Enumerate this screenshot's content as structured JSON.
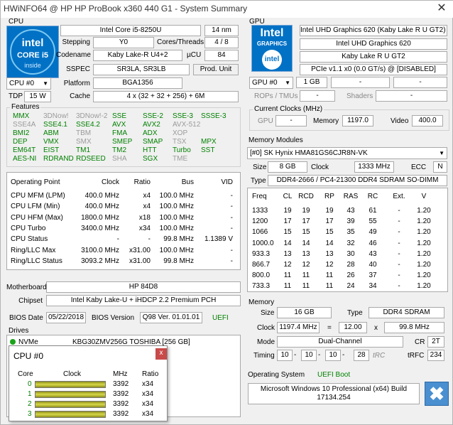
{
  "window": {
    "title": "HWiNFO64 @ HP HP ProBook x360 440 G1 - System Summary",
    "close": "✕"
  },
  "cpu": {
    "section": "CPU",
    "brand_word": "intel",
    "brand_series": "CORE i5",
    "brand_inside": "inside",
    "name": "Intel Core i5-8250U",
    "process": "14 nm",
    "stepping_label": "Stepping",
    "stepping": "Y0",
    "cores_label": "Cores/Threads",
    "cores": "4 / 8",
    "codename_label": "Codename",
    "codename": "Kaby Lake-R U4+2",
    "ucu_label": "µCU",
    "ucu": "84",
    "sspec_label": "SSPEC",
    "sspec": "SR3LA, SR3LB",
    "prod_unit": "Prod. Unit",
    "cpu_select": "CPU #0",
    "platform_label": "Platform",
    "platform": "BGA1356",
    "tdp_label": "TDP",
    "tdp": "15 W",
    "cache_label": "Cache",
    "cache": "4 x (32 + 32 + 256) + 6M"
  },
  "features": {
    "title": "Features",
    "items": [
      {
        "t": "MMX",
        "on": true
      },
      {
        "t": "3DNow!",
        "on": false
      },
      {
        "t": "3DNow!-2",
        "on": false
      },
      {
        "t": "SSE",
        "on": true
      },
      {
        "t": "SSE-2",
        "on": true
      },
      {
        "t": "SSE-3",
        "on": true
      },
      {
        "t": "SSSE-3",
        "on": true
      },
      {
        "t": "SSE4A",
        "on": false
      },
      {
        "t": "SSE4.1",
        "on": true
      },
      {
        "t": "SSE4.2",
        "on": true
      },
      {
        "t": "AVX",
        "on": true
      },
      {
        "t": "AVX2",
        "on": true
      },
      {
        "t": "AVX-512",
        "on": false
      },
      {
        "t": "BMI2",
        "on": true
      },
      {
        "t": "ABM",
        "on": true
      },
      {
        "t": "TBM",
        "on": false
      },
      {
        "t": "FMA",
        "on": true
      },
      {
        "t": "ADX",
        "on": true
      },
      {
        "t": "XOP",
        "on": false
      },
      {
        "t": "DEP",
        "on": true
      },
      {
        "t": "VMX",
        "on": true
      },
      {
        "t": "SMX",
        "on": false
      },
      {
        "t": "SMEP",
        "on": true
      },
      {
        "t": "SMAP",
        "on": true
      },
      {
        "t": "TSX",
        "on": false
      },
      {
        "t": "MPX",
        "on": true
      },
      {
        "t": "EM64T",
        "on": true
      },
      {
        "t": "EIST",
        "on": true
      },
      {
        "t": "TM1",
        "on": true
      },
      {
        "t": "TM2",
        "on": true
      },
      {
        "t": "HTT",
        "on": true
      },
      {
        "t": "Turbo",
        "on": true
      },
      {
        "t": "SST",
        "on": true
      },
      {
        "t": "AES-NI",
        "on": true
      },
      {
        "t": "RDRAND",
        "on": true
      },
      {
        "t": "RDSEED",
        "on": true
      },
      {
        "t": "SHA",
        "on": false
      },
      {
        "t": "SGX",
        "on": true
      },
      {
        "t": "TME",
        "on": false
      }
    ]
  },
  "op": {
    "headers": [
      "Operating Point",
      "Clock",
      "Ratio",
      "Bus",
      "VID"
    ],
    "rows": [
      [
        "CPU MFM (LPM)",
        "400.0 MHz",
        "x4",
        "100.0 MHz",
        "-"
      ],
      [
        "CPU LFM (Min)",
        "400.0 MHz",
        "x4",
        "100.0 MHz",
        "-"
      ],
      [
        "CPU HFM (Max)",
        "1800.0 MHz",
        "x18",
        "100.0 MHz",
        "-"
      ],
      [
        "CPU Turbo",
        "3400.0 MHz",
        "x34",
        "100.0 MHz",
        "-"
      ],
      [
        "CPU Status",
        "-",
        "-",
        "99.8 MHz",
        "1.1389 V"
      ],
      [
        "Ring/LLC Max",
        "3100.0 MHz",
        "x31.00",
        "100.0 MHz",
        "-"
      ],
      [
        "Ring/LLC Status",
        "3093.2 MHz",
        "x31.00",
        "99.8 MHz",
        "-"
      ]
    ]
  },
  "mobo": {
    "label": "Motherboard",
    "value": "HP 84D8",
    "chipset_label": "Chipset",
    "chipset": "Intel Kaby Lake-U + iHDCP 2.2 Premium PCH",
    "bios_date_label": "BIOS Date",
    "bios_date": "05/22/2018",
    "bios_ver_label": "BIOS Version",
    "bios_ver": "Q98 Ver. 01.01.01",
    "uefi": "UEFI"
  },
  "drives": {
    "title": "Drives",
    "type": "NVMe",
    "model": "KBG30ZMV256G TOSHIBA [256 GB]"
  },
  "gpu": {
    "section": "GPU",
    "brand_word": "Intel",
    "brand_sub": "GRAPHICS",
    "brand_inside": "intel",
    "name": "Intel UHD Graphics 620 (Kaby Lake R U GT2) -",
    "name2": "Intel UHD Graphics 620",
    "codename": "Kaby Lake R U GT2",
    "bus": "PCIe v1.1 x0 (0.0 GT/s) @ [DISABLED]",
    "select": "GPU #0",
    "mem": "1 GB",
    "dash1": "-",
    "dash2": "-",
    "rops_label": "ROPs / TMUs",
    "rops": "-",
    "shaders_label": "Shaders",
    "shaders": "-",
    "clocks_title": "Current Clocks (MHz)",
    "gpu_label": "GPU",
    "gpu_clk": "-",
    "memory_label": "Memory",
    "mem_clk": "1197.0",
    "video_label": "Video",
    "video_clk": "400.0"
  },
  "modules": {
    "title": "Memory Modules",
    "select": "[#0] SK Hynix HMA81GS6CJR8N-VK",
    "size_label": "Size",
    "size": "8 GB",
    "clock_label": "Clock",
    "clock": "1333 MHz",
    "ecc_label": "ECC",
    "ecc": "N",
    "type_label": "Type",
    "type": "DDR4-2666 / PC4-21300 DDR4 SDRAM SO-DIMM",
    "headers": [
      "Freq",
      "CL",
      "RCD",
      "RP",
      "RAS",
      "RC",
      "Ext.",
      "V"
    ],
    "rows": [
      [
        "1333",
        "19",
        "19",
        "19",
        "43",
        "61",
        "-",
        "1.20"
      ],
      [
        "1200",
        "17",
        "17",
        "17",
        "39",
        "55",
        "-",
        "1.20"
      ],
      [
        "1066",
        "15",
        "15",
        "15",
        "35",
        "49",
        "-",
        "1.20"
      ],
      [
        "1000.0",
        "14",
        "14",
        "14",
        "32",
        "46",
        "-",
        "1.20"
      ],
      [
        "933.3",
        "13",
        "13",
        "13",
        "30",
        "43",
        "-",
        "1.20"
      ],
      [
        "866.7",
        "12",
        "12",
        "12",
        "28",
        "40",
        "-",
        "1.20"
      ],
      [
        "800.0",
        "11",
        "11",
        "11",
        "26",
        "37",
        "-",
        "1.20"
      ],
      [
        "733.3",
        "11",
        "11",
        "11",
        "24",
        "34",
        "-",
        "1.20"
      ]
    ]
  },
  "memory": {
    "title": "Memory",
    "size_label": "Size",
    "size": "16 GB",
    "type_label": "Type",
    "type": "DDR4 SDRAM",
    "clock_label": "Clock",
    "clock": "1197.4 MHz",
    "eq": "=",
    "mult": "12.00",
    "x": "x",
    "base": "99.8 MHz",
    "mode_label": "Mode",
    "mode": "Dual-Channel",
    "cr_label": "CR",
    "cr": "2T",
    "timing_label": "Timing",
    "t1": "10",
    "t2": "10",
    "t3": "10",
    "t4": "28",
    "trc_label": "tRC",
    "trfc_label": "tRFC",
    "trfc": "234"
  },
  "os": {
    "label": "Operating System",
    "boot": "UEFI Boot",
    "value": "Microsoft Windows 10 Professional (x64) Build 17134.254"
  },
  "popup": {
    "title": "CPU #0",
    "close": "x",
    "headers": [
      "Core",
      "Clock",
      "MHz",
      "Ratio"
    ],
    "rows": [
      {
        "core": "0",
        "mhz": "3392",
        "ratio": "x34",
        "fill": 1.0
      },
      {
        "core": "1",
        "mhz": "3392",
        "ratio": "x34",
        "fill": 1.0
      },
      {
        "core": "2",
        "mhz": "3392",
        "ratio": "x34",
        "fill": 1.0
      },
      {
        "core": "3",
        "mhz": "3392",
        "ratio": "x34",
        "fill": 1.0
      }
    ]
  }
}
